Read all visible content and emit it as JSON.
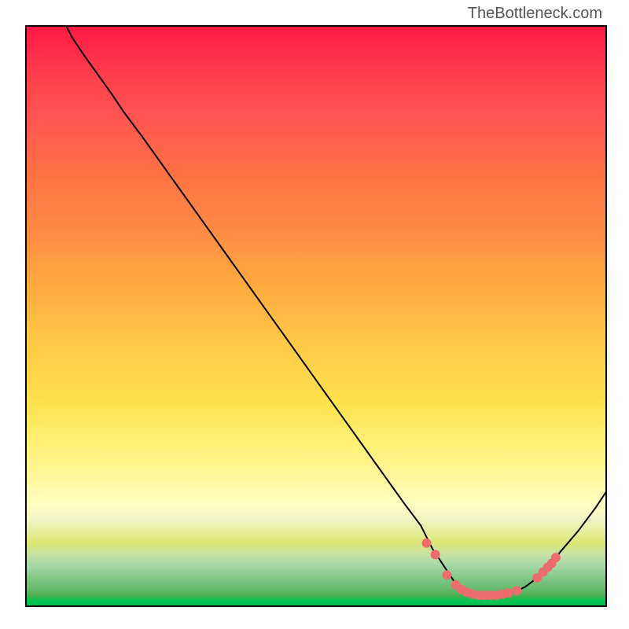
{
  "attribution": "TheBottleneck.com",
  "chart_data": {
    "type": "line",
    "title": "",
    "xlabel": "",
    "ylabel": "",
    "xlim": [
      0,
      100
    ],
    "ylim": [
      0,
      100
    ],
    "curve_points": [
      {
        "x": 7,
        "y": 100
      },
      {
        "x": 8,
        "y": 98
      },
      {
        "x": 10,
        "y": 95
      },
      {
        "x": 15,
        "y": 88
      },
      {
        "x": 17,
        "y": 85
      },
      {
        "x": 20,
        "y": 81
      },
      {
        "x": 25,
        "y": 74
      },
      {
        "x": 30,
        "y": 67
      },
      {
        "x": 35,
        "y": 60
      },
      {
        "x": 40,
        "y": 53
      },
      {
        "x": 45,
        "y": 46
      },
      {
        "x": 50,
        "y": 39
      },
      {
        "x": 55,
        "y": 32
      },
      {
        "x": 60,
        "y": 25
      },
      {
        "x": 65,
        "y": 18
      },
      {
        "x": 68,
        "y": 14
      },
      {
        "x": 70,
        "y": 10
      },
      {
        "x": 72,
        "y": 7
      },
      {
        "x": 74,
        "y": 4
      },
      {
        "x": 76,
        "y": 2.5
      },
      {
        "x": 78,
        "y": 2
      },
      {
        "x": 80,
        "y": 2
      },
      {
        "x": 82,
        "y": 2
      },
      {
        "x": 84,
        "y": 2.5
      },
      {
        "x": 86,
        "y": 3.5
      },
      {
        "x": 88,
        "y": 5
      },
      {
        "x": 90,
        "y": 7
      },
      {
        "x": 92,
        "y": 9.5
      },
      {
        "x": 95,
        "y": 13
      },
      {
        "x": 98,
        "y": 17
      },
      {
        "x": 100,
        "y": 20
      }
    ],
    "dots": [
      {
        "x": 69,
        "y": 11
      },
      {
        "x": 70.5,
        "y": 9
      },
      {
        "x": 72.5,
        "y": 5.5
      },
      {
        "x": 74,
        "y": 3.8
      },
      {
        "x": 75,
        "y": 3
      },
      {
        "x": 76,
        "y": 2.5
      },
      {
        "x": 77,
        "y": 2.2
      },
      {
        "x": 78,
        "y": 2
      },
      {
        "x": 79,
        "y": 2
      },
      {
        "x": 80,
        "y": 2
      },
      {
        "x": 81,
        "y": 2
      },
      {
        "x": 82,
        "y": 2.2
      },
      {
        "x": 83,
        "y": 2.4
      },
      {
        "x": 84.5,
        "y": 2.8
      },
      {
        "x": 88,
        "y": 5
      },
      {
        "x": 89,
        "y": 6
      },
      {
        "x": 89.8,
        "y": 6.8
      },
      {
        "x": 90.5,
        "y": 7.5
      },
      {
        "x": 91.2,
        "y": 8.5
      }
    ]
  }
}
